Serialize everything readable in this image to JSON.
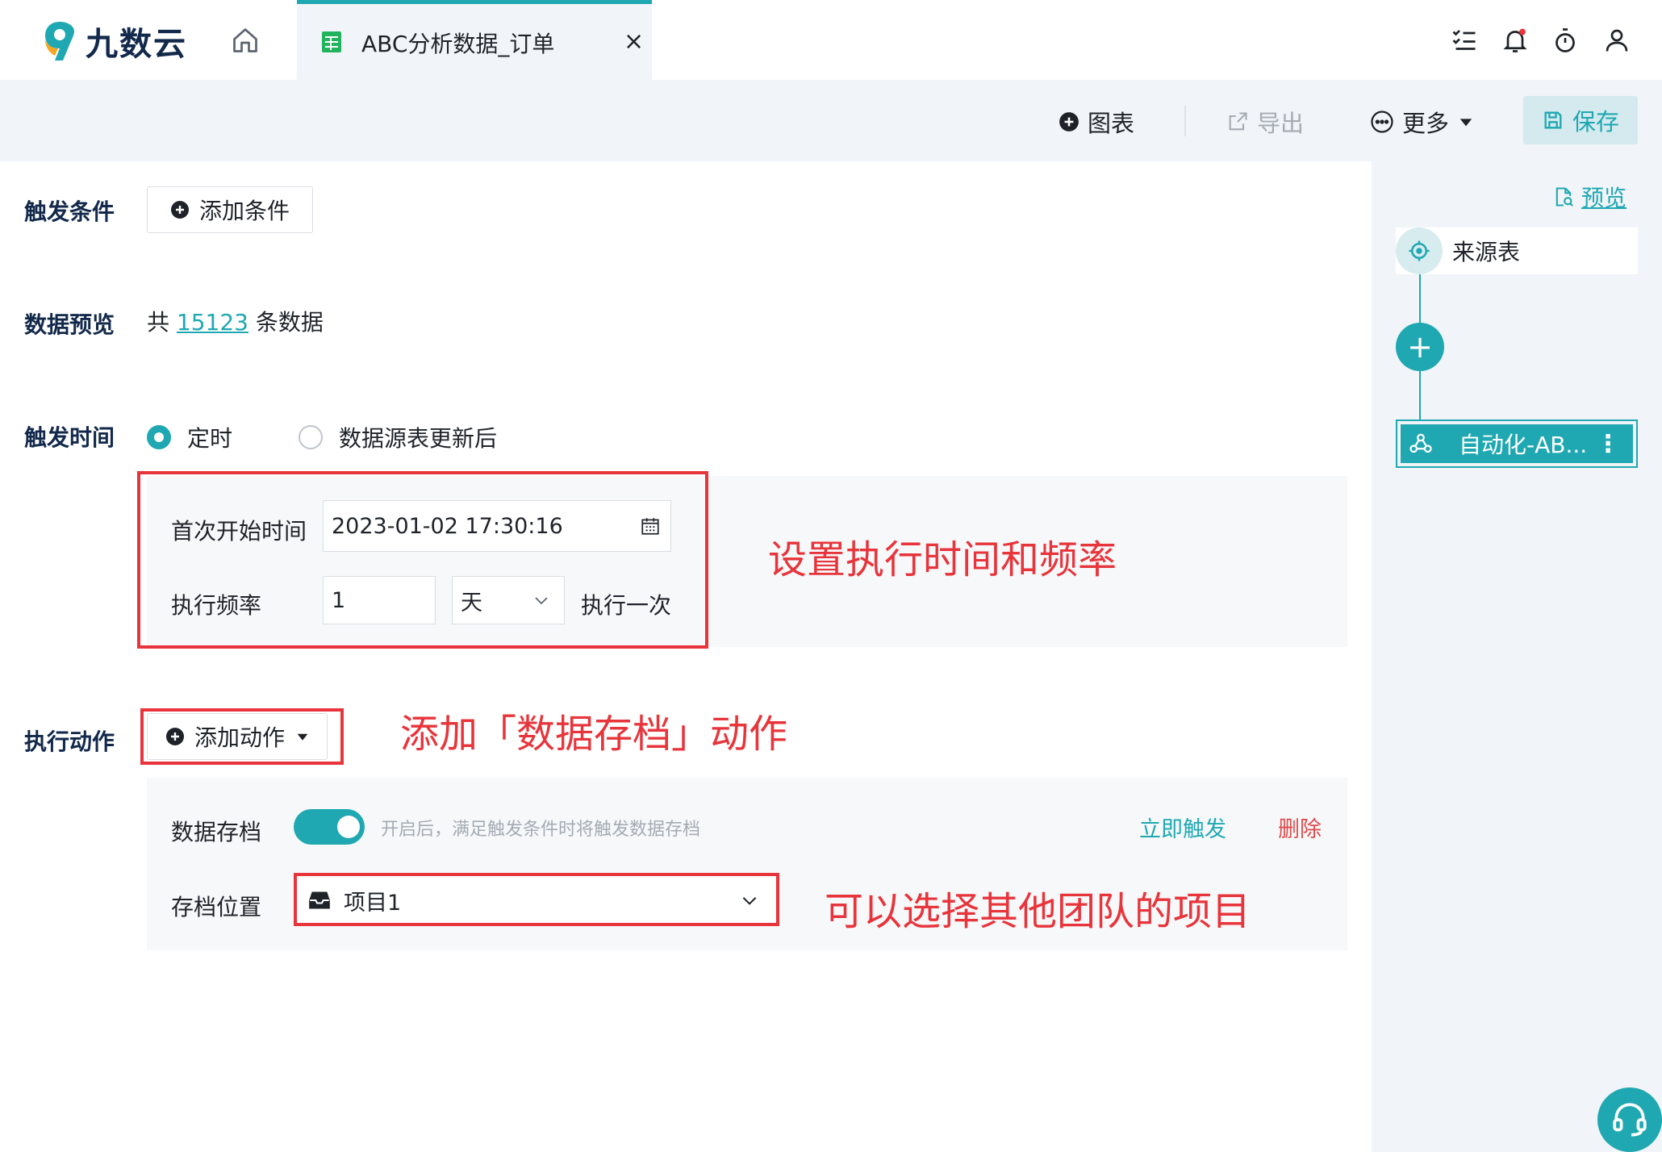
{
  "app": {
    "logo_text": "九数云"
  },
  "tab": {
    "title": "ABC分析数据_订单",
    "close": "×"
  },
  "toolbar": {
    "chart_label": "图表",
    "export_label": "导出",
    "more_label": "更多",
    "save_label": "保存"
  },
  "form": {
    "trigger_condition_label": "触发条件",
    "add_condition_label": "添加条件",
    "data_preview_label": "数据预览",
    "preview_prefix": "共",
    "preview_count": "15123",
    "preview_suffix": "条数据",
    "trigger_time_label": "触发时间",
    "radio_scheduled": "定时",
    "radio_after_update": "数据源表更新后",
    "first_start_label": "首次开始时间",
    "first_start_value": "2023-01-02 17:30:16",
    "frequency_label": "执行频率",
    "frequency_value": "1",
    "frequency_unit": "天",
    "frequency_suffix": "执行一次",
    "action_label": "执行动作",
    "add_action_label": "添加动作"
  },
  "action": {
    "archive_label": "数据存档",
    "archive_enabled": true,
    "archive_hint": "开启后，满足触发条件时将触发数据存档",
    "trigger_now": "立即触发",
    "delete": "删除",
    "location_label": "存档位置",
    "location_value": "项目1"
  },
  "annotations": {
    "note_schedule": "设置执行时间和频率",
    "note_action": "添加「数据存档」动作",
    "note_location": "可以选择其他团队的项目"
  },
  "flow": {
    "preview_label": "预览",
    "source_node": "来源表",
    "add_node": "+",
    "auto_node": "自动化-AB...",
    "auto_node_menu": "⋮"
  },
  "colors": {
    "accent": "#1fa8b2",
    "annotation_red": "#e8343b",
    "danger": "#e04b4b",
    "heading": "#13294b"
  }
}
